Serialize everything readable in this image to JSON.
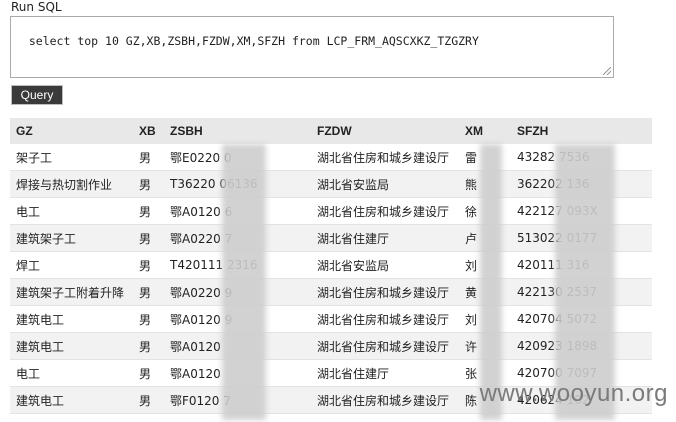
{
  "label": "Run SQL",
  "sql": "select top 10 GZ,XB,ZSBH,FZDW,XM,SFZH from LCP_FRM_AQSCXKZ_TZGZRY",
  "button": "Query",
  "columns": [
    "GZ",
    "XB",
    "ZSBH",
    "FZDW",
    "XM",
    "SFZH"
  ],
  "rows": [
    [
      "架子工",
      "男",
      "鄂E0220      0",
      "湖北省住房和城乡建设厅",
      "雷",
      "43282      7536"
    ],
    [
      "焊接与热切割作业",
      "男",
      "T36220      06136",
      "湖北省安监局",
      "熊",
      "362202      136"
    ],
    [
      "电工",
      "男",
      "鄂A0120      6",
      "湖北省住房和城乡建设厅",
      "徐",
      "422127      093X"
    ],
    [
      "建筑架子工",
      "男",
      "鄂A0220      7",
      "湖北省住建厅",
      "卢",
      "513022      0177"
    ],
    [
      "焊工",
      "男",
      "T420111      2316",
      "湖北省安监局",
      "刘",
      "420111      316"
    ],
    [
      "建筑架子工附着升降",
      "男",
      "鄂A0220      9",
      "湖北省住房和城乡建设厅",
      "黄",
      "422130      2537"
    ],
    [
      "建筑电工",
      "男",
      "鄂A0120      9",
      "湖北省住房和城乡建设厅",
      "刘",
      "420704      5072"
    ],
    [
      "建筑电工",
      "男",
      "鄂A0120      ",
      "湖北省住房和城乡建设厅",
      "许",
      "420923      1898"
    ],
    [
      "电工",
      "男",
      "鄂A0120      ",
      "湖北省住建厅",
      "张",
      "420700      7097"
    ],
    [
      "建筑电工",
      "男",
      "鄂F0120      7",
      "湖北省住房和城乡建设厅",
      "陈",
      "420624      102"
    ]
  ],
  "watermark": "www.wooyun.org"
}
